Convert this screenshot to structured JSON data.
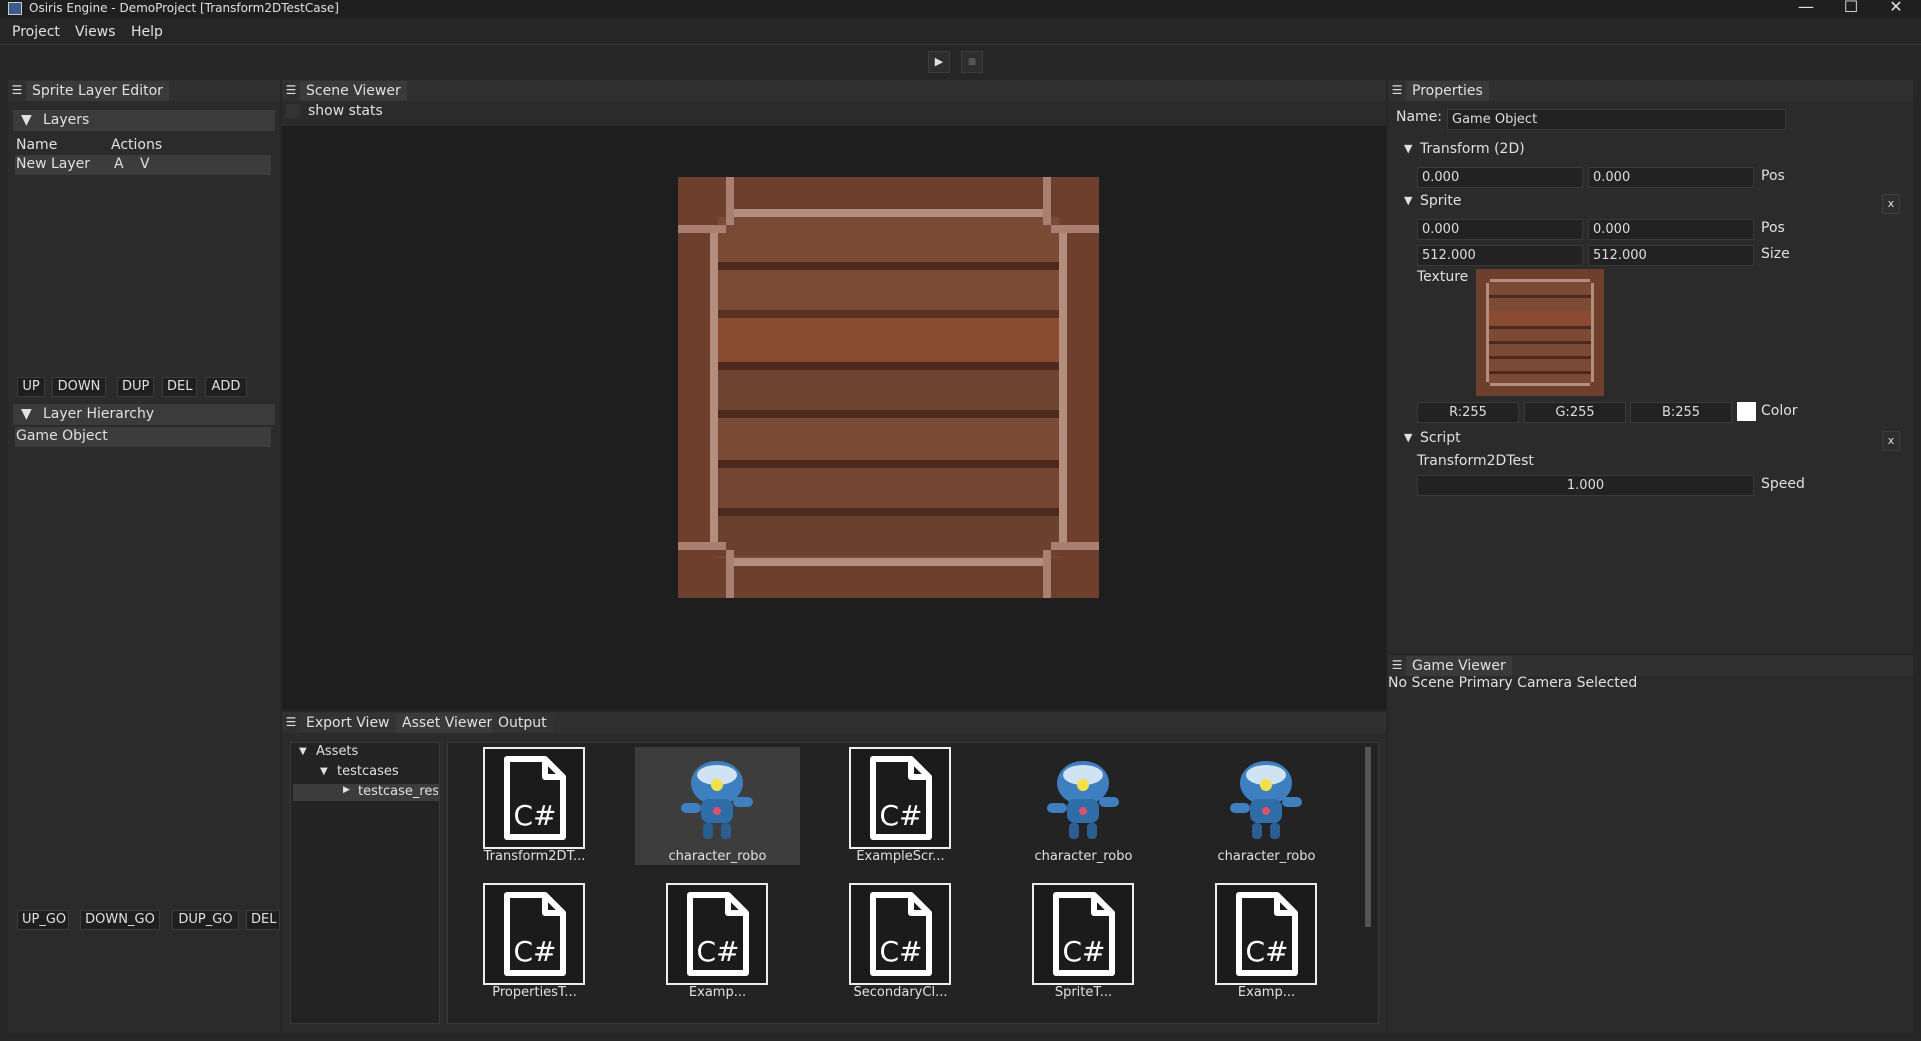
{
  "window": {
    "title": "Osiris Engine - DemoProject [Transform2DTestCase]",
    "minimize": "—",
    "maximize": "☐",
    "close": "✕"
  },
  "menu": [
    "Project",
    "Views",
    "Help"
  ],
  "toolbar": {
    "play": "▶",
    "stop": "■"
  },
  "sprite_layer_editor": {
    "tab": "Sprite Layer Editor",
    "layers_header": "Layers",
    "columns": [
      "Name",
      "Actions"
    ],
    "layers": [
      {
        "name": "New Layer",
        "up": "A",
        "down": "V"
      }
    ],
    "layer_buttons": [
      "UP",
      "DOWN",
      "DUP",
      "DEL",
      "ADD"
    ],
    "hierarchy_header": "Layer Hierarchy",
    "hierarchy_items": [
      "Game Object"
    ],
    "go_buttons": [
      "UP_GO",
      "DOWN_GO",
      "DUP_GO",
      "DEL"
    ]
  },
  "scene_viewer": {
    "tab": "Scene Viewer",
    "show_stats": "show stats"
  },
  "properties": {
    "tab": "Properties",
    "name_label": "Name:",
    "name_value": "Game Object",
    "transform": {
      "header": "Transform (2D)",
      "x": "0.000",
      "y": "0.000",
      "label": "Pos"
    },
    "sprite": {
      "header": "Sprite",
      "remove": "x",
      "pos_x": "0.000",
      "pos_y": "0.000",
      "pos_label": "Pos",
      "size_x": "512.000",
      "size_y": "512.000",
      "size_label": "Size",
      "texture_label": "Texture",
      "r": "R:255",
      "g": "G:255",
      "b": "B:255",
      "color_label": "Color",
      "color_swatch": "#ffffff"
    },
    "script": {
      "header": "Script",
      "remove": "x",
      "name": "Transform2DTest",
      "speed_value": "1.000",
      "speed_label": "Speed"
    }
  },
  "game_viewer": {
    "tab": "Game Viewer",
    "message": "No Scene Primary Camera Selected"
  },
  "bottom_tabs": [
    "Export View",
    "Asset Viewer",
    "Output"
  ],
  "asset_tree": {
    "root": "Assets",
    "child": "testcases",
    "grandchild": "testcase_res"
  },
  "assets": [
    {
      "name": "Transform2DT...",
      "kind": "script"
    },
    {
      "name": "character_robo",
      "kind": "image"
    },
    {
      "name": "ExampleScr...",
      "kind": "script"
    },
    {
      "name": "character_robo",
      "kind": "image"
    },
    {
      "name": "character_robo",
      "kind": "image"
    },
    {
      "name": "PropertiesT...",
      "kind": "script"
    },
    {
      "name": "Examp...",
      "kind": "script"
    },
    {
      "name": "SecondaryCl...",
      "kind": "script"
    },
    {
      "name": "SpriteT...",
      "kind": "script"
    },
    {
      "name": "Examp...",
      "kind": "script"
    }
  ],
  "cs_icon_text": "C#"
}
